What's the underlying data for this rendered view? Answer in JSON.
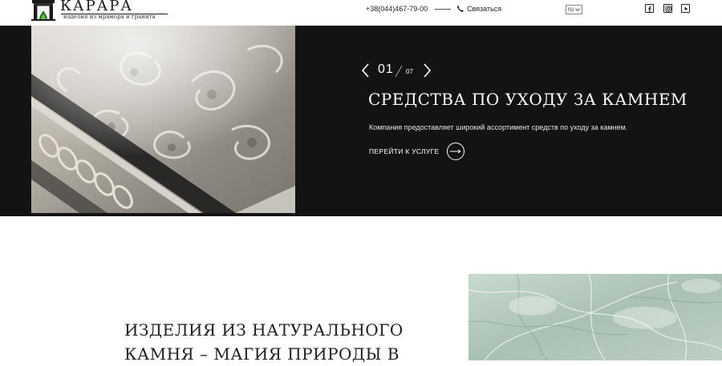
{
  "header": {
    "logo_name": "КАРАРА",
    "logo_tagline": "изделия из мрамора и гранита",
    "phone": "+38(044)467-79-00",
    "call_label": "Связаться",
    "language": "ru",
    "social_icons": [
      "facebook-icon",
      "instagram-icon",
      "youtube-icon"
    ]
  },
  "hero": {
    "current_slide": "01",
    "total_slides": "07",
    "title": "СРЕДСТВА ПО УХОДУ ЗА КАМНЕМ",
    "description": "Компания предоставляет широкий ассортимент средств по уходу за камнем.",
    "cta_label": "ПЕРЕЙТИ К УСЛУГЕ"
  },
  "about": {
    "title_line1": "ИЗДЕЛИЯ ИЗ НАТУРАЛЬНОГО",
    "title_line2": "КАМНЯ – МАГИЯ ПРИРОДЫ В"
  },
  "colors": {
    "hero_background": "#131313",
    "text_dark": "#1a1a1a",
    "marble_green": "#b7cbbf"
  }
}
